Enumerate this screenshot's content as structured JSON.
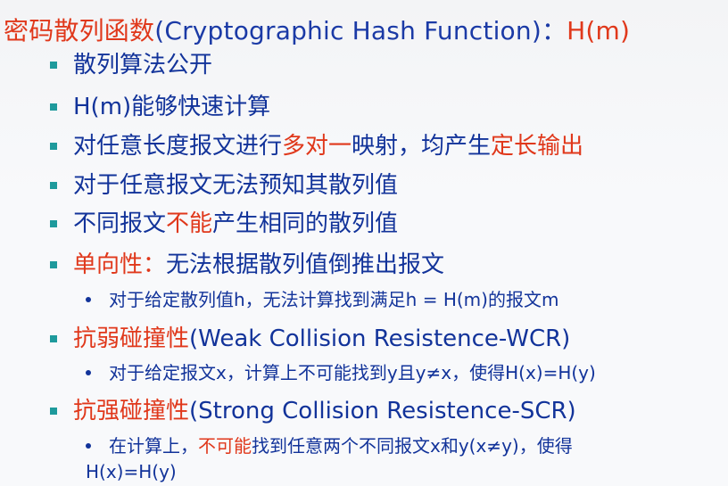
{
  "title": {
    "cn": "密码散列函数",
    "en": "(Cryptographic Hash Function)",
    "colon": "：",
    "hm": "H(m)"
  },
  "bullets": [
    {
      "text": "散列算法公开"
    },
    {
      "text": "H(m)能够快速计算"
    },
    {
      "part1": "对任意长度报文进行",
      "part2": "多对一",
      "part3": "映射，均产生",
      "part4": "定长输出"
    },
    {
      "text": "对于任意报文无法预知其散列值"
    },
    {
      "part1": "不同报文",
      "part2": "不能",
      "part3": "产生相同的散列值"
    },
    {
      "part1": "单向性：",
      "part2": "无法根据散列值倒推出报文"
    },
    {
      "part1": "抗弱碰撞性",
      "part2": "(Weak Collision Resistence-WCR)"
    },
    {
      "part1": "抗强碰撞性",
      "part2": "(Strong Collision Resistence-SCR)"
    }
  ],
  "subs": {
    "oneway": "对于给定散列值h，无法计算找到满足h = H(m)的报文m",
    "wcr": "对于给定报文x，计算上不可能找到y且y≠x，使得H(x)=H(y)",
    "scr_part1": "在计算上，",
    "scr_part2": "不可能",
    "scr_part3": "找到任意两个不同报文x和y(x≠y)，使得",
    "scr_line2": "H(x)=H(y)"
  },
  "colors": {
    "red": "#e0381b",
    "blue": "#12339a",
    "bullet_square": "#1e9a9c",
    "background": "#f6f7f9"
  }
}
